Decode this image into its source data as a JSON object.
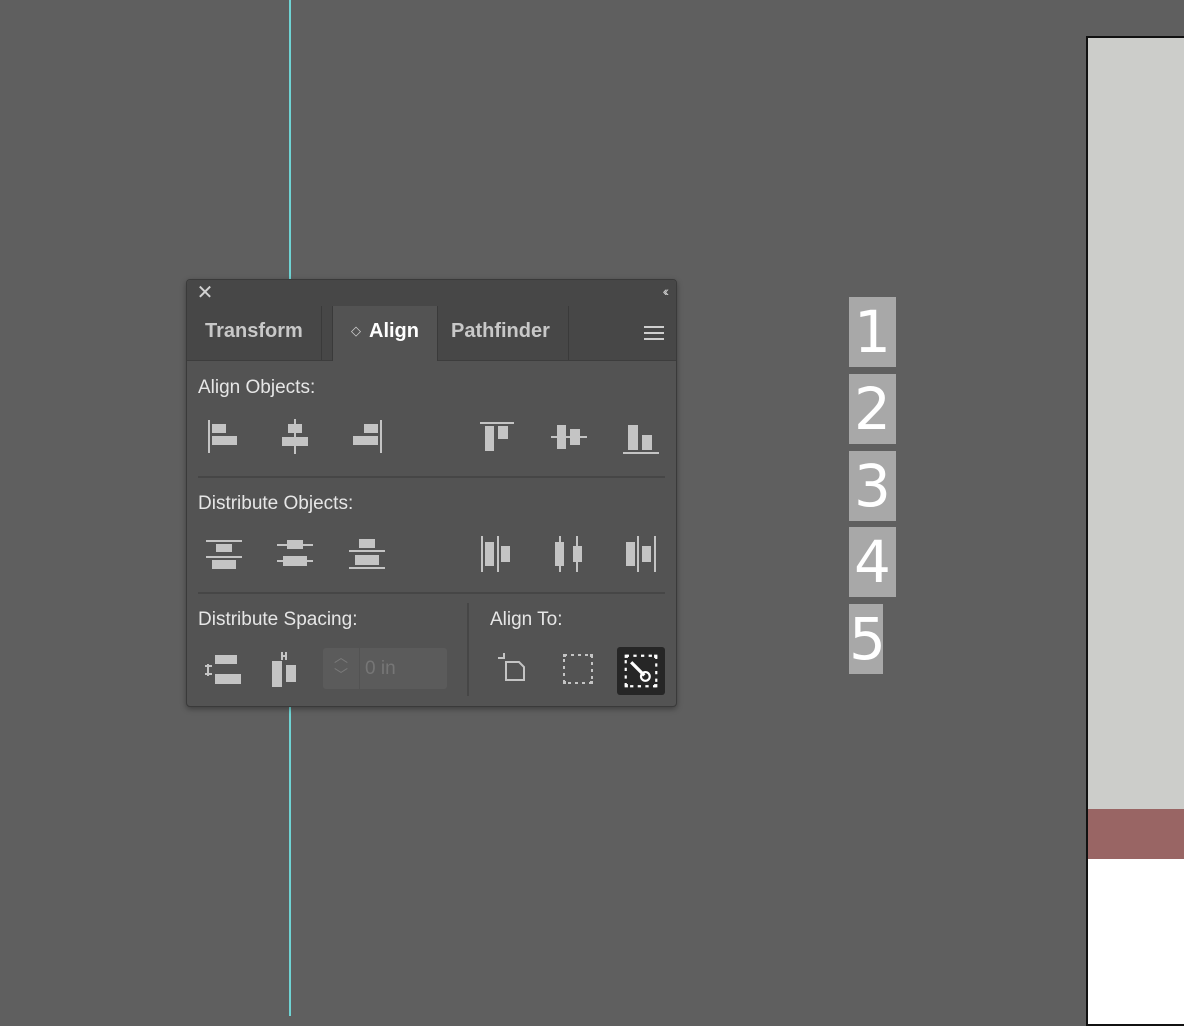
{
  "panel": {
    "tabs": [
      {
        "label": "Transform"
      },
      {
        "label": "Align"
      },
      {
        "label": "Pathfinder"
      }
    ],
    "active_tab": "Align",
    "sections": {
      "align_objects": "Align Objects:",
      "distribute_objects": "Distribute Objects:",
      "distribute_spacing": "Distribute Spacing:",
      "align_to": "Align To:"
    },
    "spacing_value": "0 in",
    "align_to_selected": "key-object"
  },
  "canvas": {
    "numbers": [
      "1",
      "2",
      "3",
      "4",
      "5"
    ],
    "colors": {
      "background": "#5f5f5f",
      "guide": "#6fd3d3",
      "number_box": "#a8a8a8",
      "artboard_gray": "#cccdca",
      "artboard_red": "#996564"
    }
  }
}
